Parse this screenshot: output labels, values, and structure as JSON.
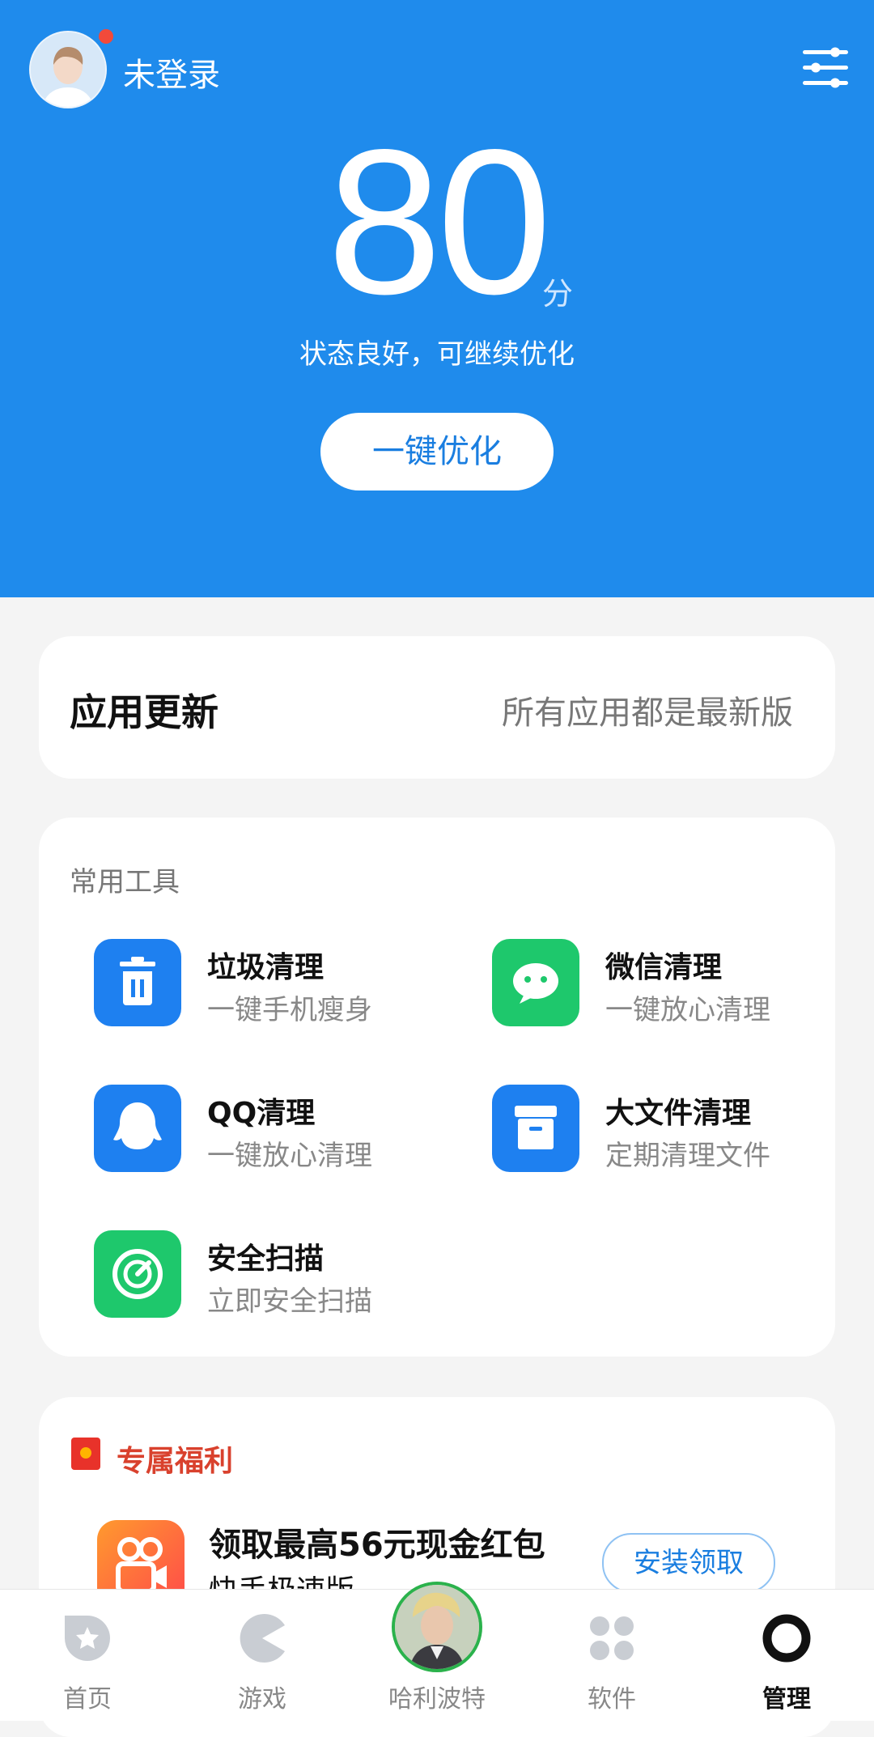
{
  "header": {
    "login_status": "未登录",
    "score": "80",
    "score_unit": "分",
    "status_text": "状态良好，可继续优化",
    "optimize_button": "一键优化"
  },
  "app_update": {
    "title": "应用更新",
    "status": "所有应用都是最新版"
  },
  "tools": {
    "title": "常用工具",
    "items": [
      {
        "name": "垃圾清理",
        "desc": "一键手机瘦身",
        "icon": "trash-icon"
      },
      {
        "name": "微信清理",
        "desc": "一键放心清理",
        "icon": "wechat-icon"
      },
      {
        "name": "QQ清理",
        "desc": "一键放心清理",
        "icon": "qq-icon"
      },
      {
        "name": "大文件清理",
        "desc": "定期清理文件",
        "icon": "archive-icon"
      },
      {
        "name": "安全扫描",
        "desc": "立即安全扫描",
        "icon": "radar-scan-icon"
      }
    ]
  },
  "welfare": {
    "title": "专属福利",
    "promo_title": "领取最高56元现金红包",
    "promo_subtitle": "快手极速版",
    "install_button": "安装领取"
  },
  "bottom_nav": {
    "items": [
      {
        "label": "首页",
        "icon": "home-star-icon"
      },
      {
        "label": "游戏",
        "icon": "pacman-game-icon"
      },
      {
        "label": "哈利波特",
        "icon": "harry-potter-avatar"
      },
      {
        "label": "软件",
        "icon": "apps-grid-icon"
      },
      {
        "label": "管理",
        "icon": "manage-ring-icon"
      }
    ],
    "active_index": 4
  },
  "colors": {
    "primary_blue": "#1f8bec",
    "tool_blue": "#1e80f0",
    "tool_green": "#1ec86c",
    "welfare_red": "#d9412d"
  }
}
